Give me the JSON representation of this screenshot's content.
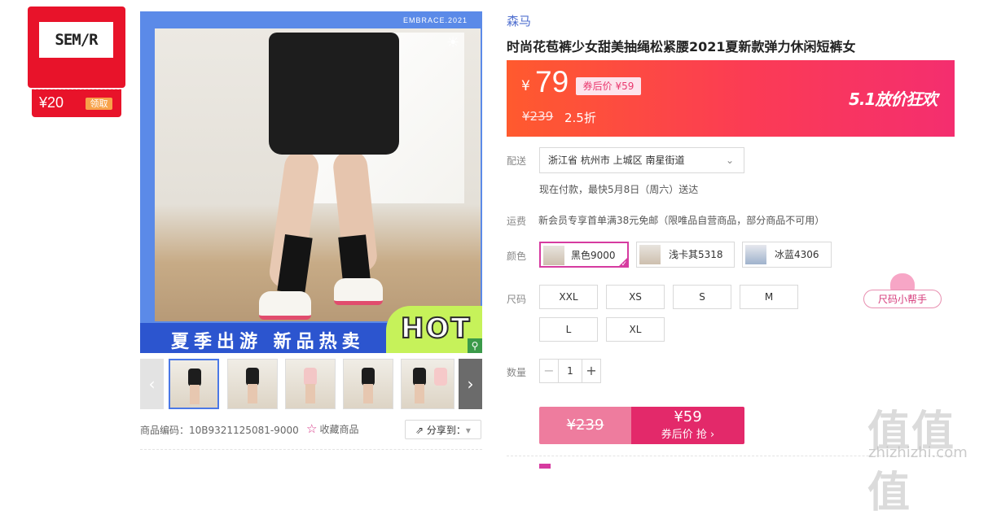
{
  "store": {
    "logo_text": "SEM/R",
    "coupon_amount": "¥20",
    "coupon_claim": "领取"
  },
  "gallery": {
    "brand_tag": "EMBRACE.2021",
    "banner_text": "夏季出游  新品热卖",
    "hot_text": "HOT",
    "prev_icon": "‹",
    "next_icon": "›",
    "zoom_icon": "magnifier-icon",
    "thumbnail_count": 6
  },
  "meta": {
    "sku": "商品编码：10B9321125081-9000",
    "favorite": "收藏商品",
    "share": "分享到：",
    "share_caret": "▾"
  },
  "product": {
    "brand": "森马",
    "title": "时尚花苞裤少女甜美抽绳松紧腰2021夏新款弹力休闲短裤女"
  },
  "price": {
    "currency": "¥",
    "current": "79",
    "after_coupon": "券后价 ¥59",
    "original": "¥239",
    "discount": "2.5折",
    "promo": "5.1放价狂欢"
  },
  "delivery": {
    "label": "配送",
    "address": "浙江省 杭州市 上城区 南星街道",
    "eta": "现在付款，最快5月8日（周六）送达"
  },
  "shipping": {
    "label": "运费",
    "text": "新会员专享首单满38元免邮（限唯品自营商品，部分商品不可用）"
  },
  "colors": {
    "label": "颜色",
    "options": [
      "黑色9000",
      "浅卡其5318",
      "冰蓝4306"
    ],
    "selected": "黑色9000"
  },
  "sizes": {
    "label": "尺码",
    "options": [
      "XXL",
      "XS",
      "S",
      "M",
      "L",
      "XL"
    ],
    "helper": "尺码小帮手"
  },
  "quantity": {
    "label": "数量",
    "minus": "−",
    "value": "1",
    "plus": "+"
  },
  "buy": {
    "original": "¥239",
    "price": "¥59",
    "action": "券后价 抢 ›"
  },
  "watermark": {
    "text": "值值值",
    "url": "zhizhizhi.com"
  },
  "colors_theme": {
    "accent_red": "#e8132a",
    "price_gradient_start": "#ff5a2e",
    "price_gradient_end": "#f42e6f",
    "brand_link": "#4f6fcf",
    "select_pink": "#d63ba0",
    "buy_dark": "#e3296a",
    "buy_light": "#ee7c9e"
  }
}
